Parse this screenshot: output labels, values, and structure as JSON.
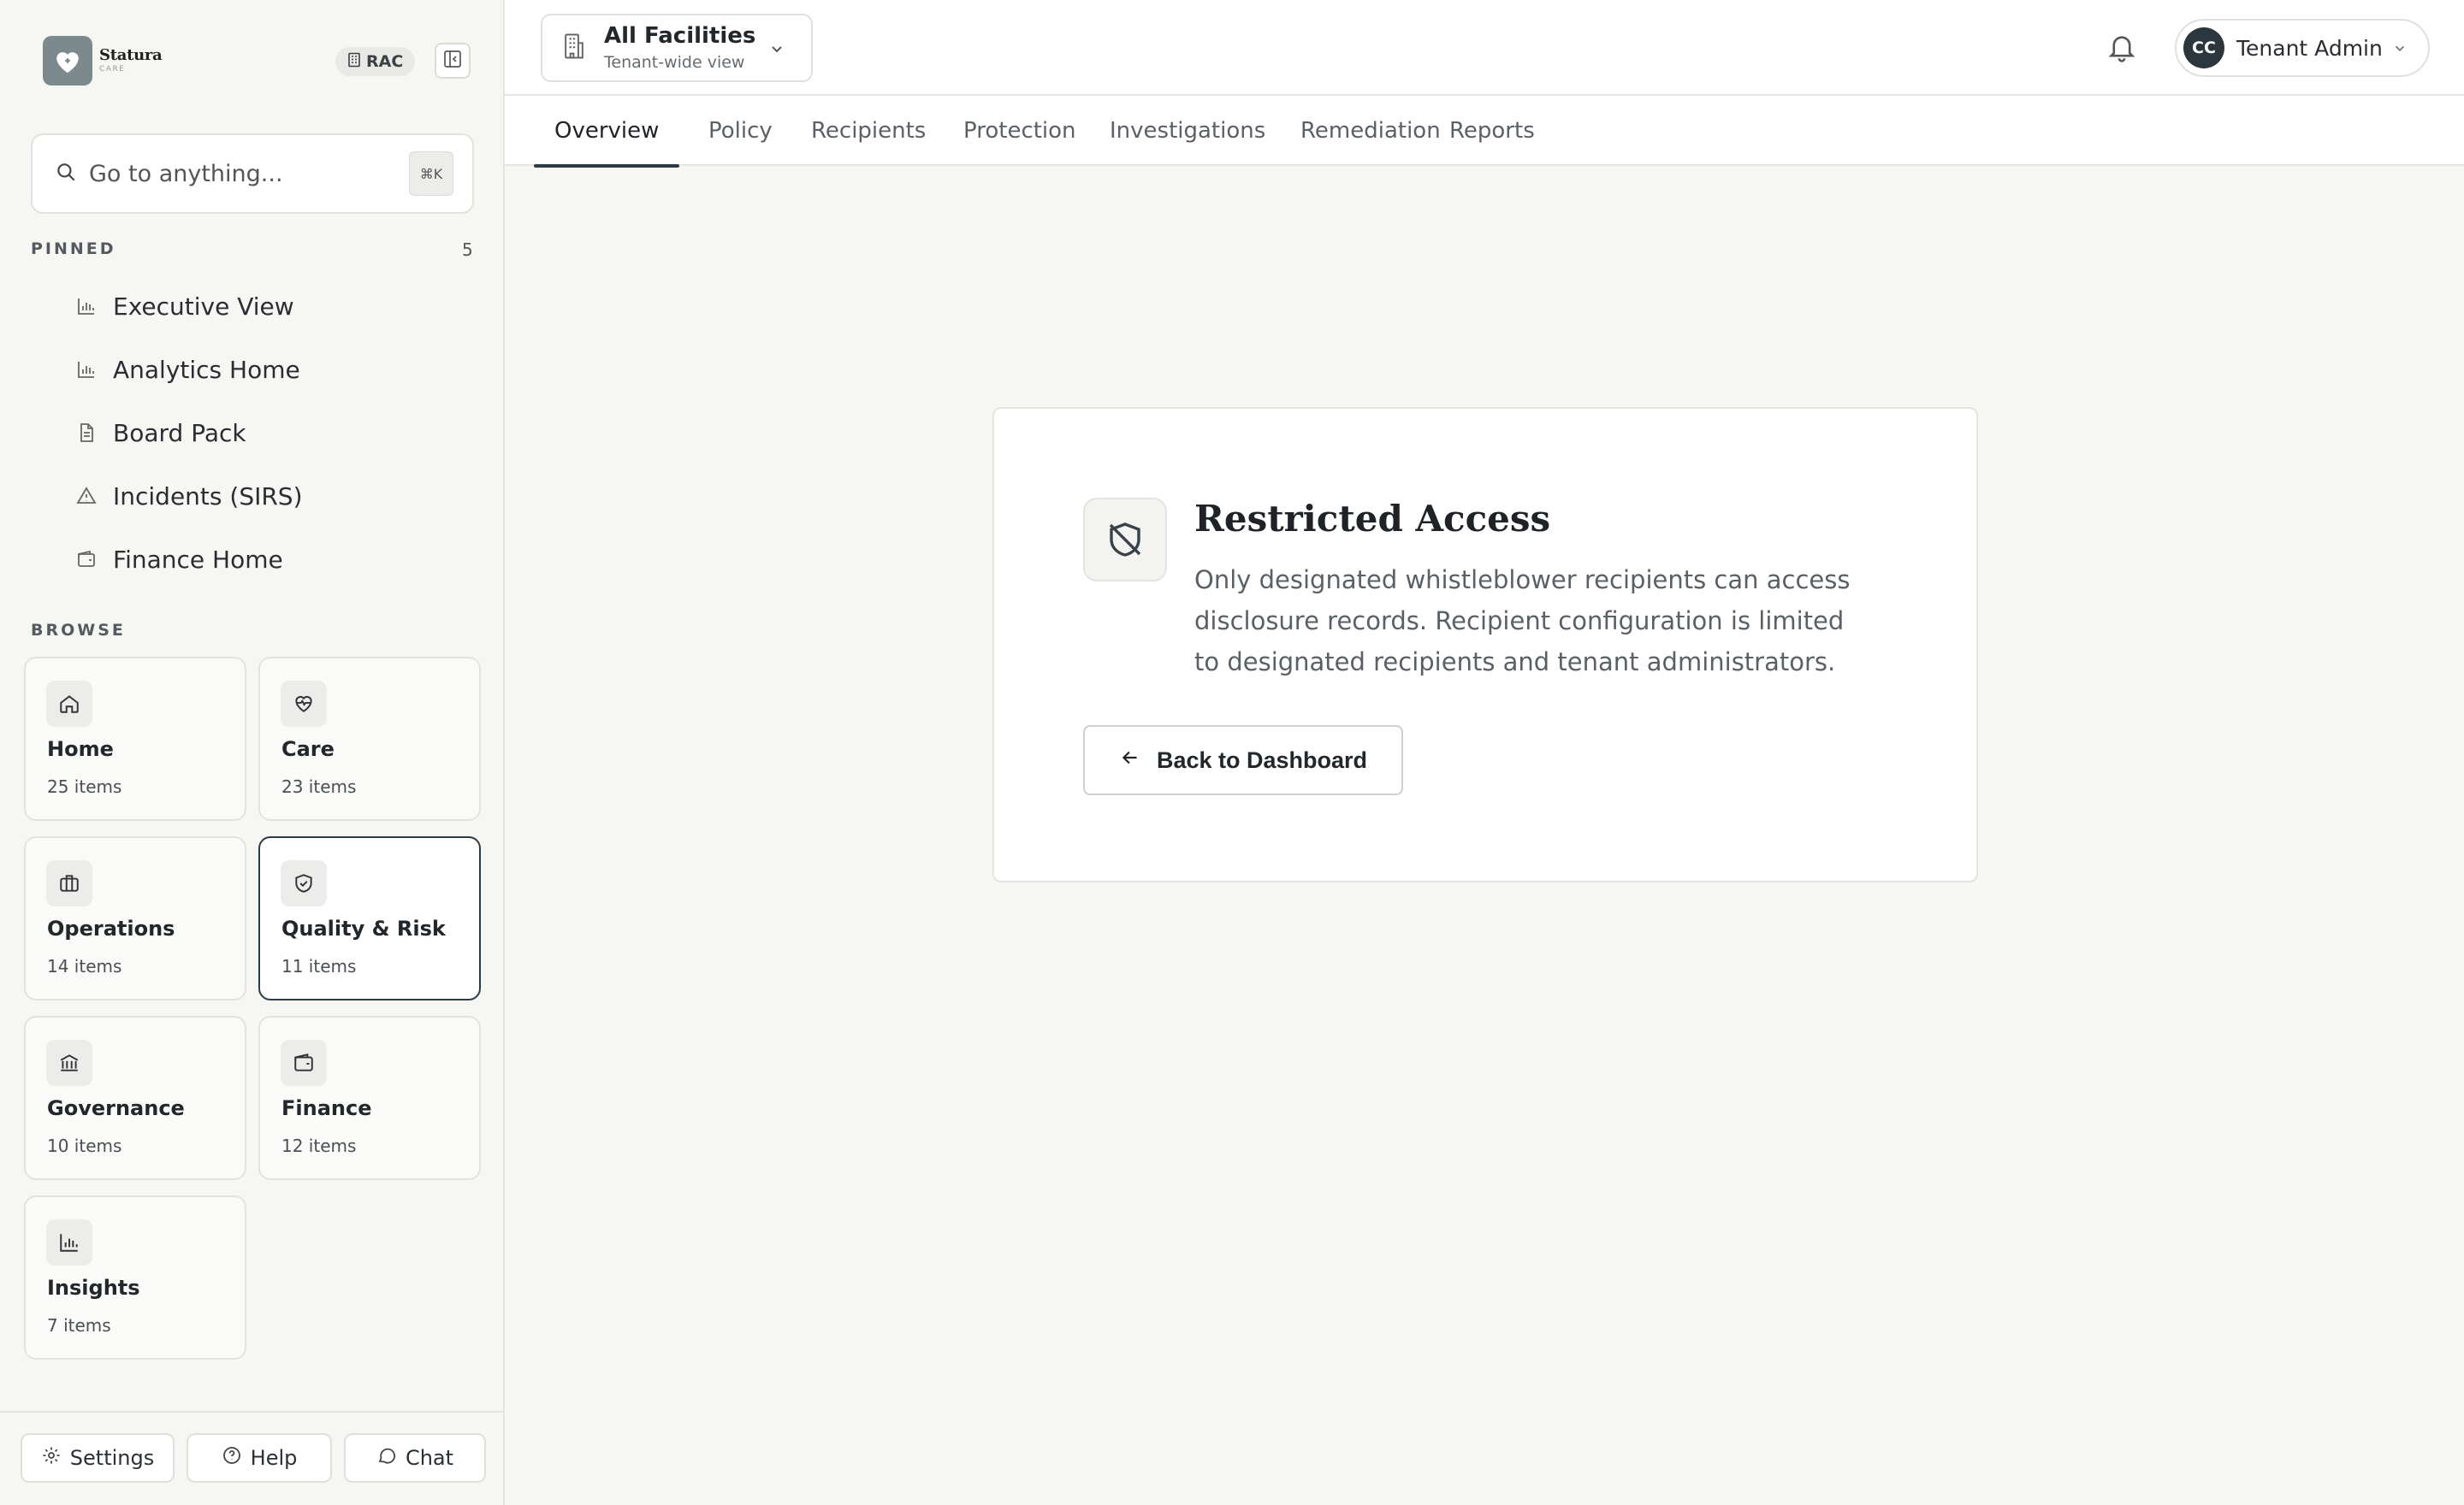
{
  "brand": {
    "name": "Statura",
    "sub": "CARE",
    "badge": "RAC"
  },
  "search": {
    "placeholder": "Go to anything...",
    "shortcut": "⌘K"
  },
  "pinned": {
    "label": "PINNED",
    "count": "5",
    "items": [
      {
        "label": "Executive View",
        "icon": "bar-chart-icon"
      },
      {
        "label": "Analytics Home",
        "icon": "bar-chart-icon"
      },
      {
        "label": "Board Pack",
        "icon": "document-icon"
      },
      {
        "label": "Incidents (SIRS)",
        "icon": "warning-icon"
      },
      {
        "label": "Finance Home",
        "icon": "wallet-icon"
      }
    ]
  },
  "browse": {
    "label": "BROWSE",
    "cards": [
      {
        "title": "Home",
        "count": "25 items",
        "icon": "home-icon"
      },
      {
        "title": "Care",
        "count": "23 items",
        "icon": "heart-pulse-icon"
      },
      {
        "title": "Operations",
        "count": "14 items",
        "icon": "briefcase-icon"
      },
      {
        "title": "Quality & Risk",
        "count": "11 items",
        "icon": "shield-check-icon",
        "active": true
      },
      {
        "title": "Governance",
        "count": "10 items",
        "icon": "bank-icon"
      },
      {
        "title": "Finance",
        "count": "12 items",
        "icon": "wallet-icon"
      },
      {
        "title": "Insights",
        "count": "7 items",
        "icon": "bar-chart-icon"
      }
    ]
  },
  "footer": {
    "settings": "Settings",
    "help": "Help",
    "chat": "Chat"
  },
  "facility": {
    "title": "All Facilities",
    "subtitle": "Tenant-wide view"
  },
  "user": {
    "initials": "CC",
    "name": "Tenant Admin"
  },
  "tabs": [
    "Overview",
    "Policy",
    "Recipients",
    "Protection",
    "Investigations",
    "Remediation",
    "Reports"
  ],
  "active_tab": "Overview",
  "restricted": {
    "title": "Restricted Access",
    "description": "Only designated whistleblower recipients can access disclosure records. Recipient configuration is limited to designated recipients and tenant administrators.",
    "button": "Back to Dashboard"
  },
  "colors": {
    "accent": "#2d3b45",
    "background": "#f6f6f3",
    "logo": "#7d8a8d"
  }
}
